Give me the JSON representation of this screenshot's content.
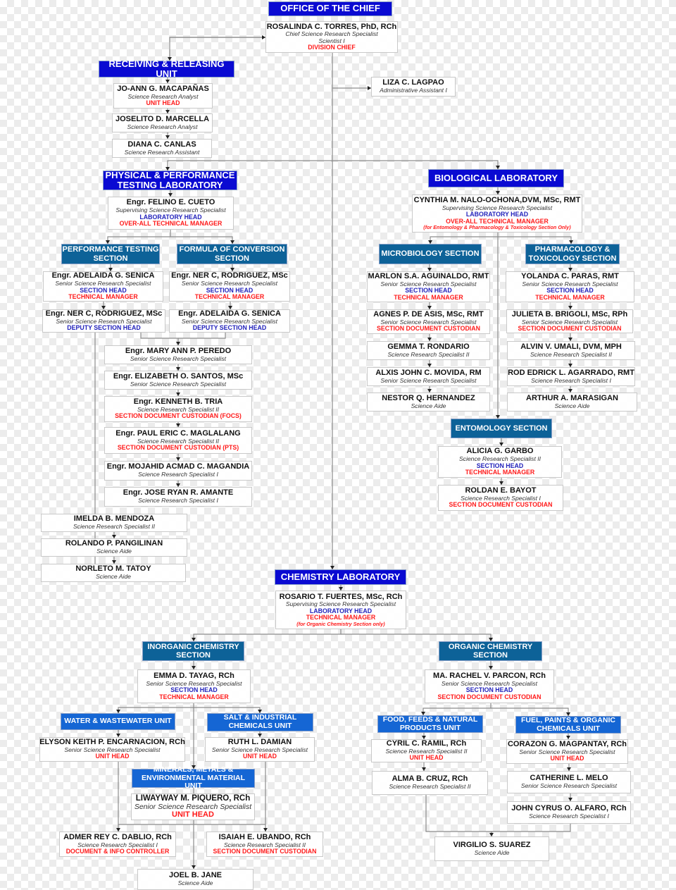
{
  "colors": {
    "office_header": "#0a0ad2",
    "section_header": "#0d6298",
    "unit_header": "#1566d4",
    "red_role": "#ff1a1a",
    "blue_role": "#2222bb",
    "connector": "#8c8c8c"
  },
  "headers": {
    "chief": "OFFICE OF THE CHIEF",
    "rru": "RECEIVING & RELEASING UNIT",
    "ppt": "PHYSICAL & PERFORMANCE TESTING LABORATORY",
    "bio": "BIOLOGICAL LABORATORY",
    "chem": "CHEMISTRY LABORATORY",
    "perf": "PERFORMANCE TESTING SECTION",
    "foc": "FORMULA OF CONVERSION SECTION",
    "micro": "MICROBIOLOGY SECTION",
    "pharm": "PHARMACOLOGY & TOXICOLOGY SECTION",
    "ento": "ENTOMOLOGY  SECTION",
    "inorg": "INORGANIC CHEMISTRY SECTION",
    "org": "ORGANIC CHEMISTRY SECTION",
    "water": "WATER & WASTEWATER UNIT",
    "salt": "SALT & INDUSTRIAL CHEMICALS UNIT",
    "minerals": "MINERALS, METALS & ENVIRONMENTAL MATERIAL UNIT",
    "food": "FOOD, FEEDS & NATURAL PRODUCTS UNIT",
    "fuel": "FUEL, PAINTS & ORGANIC CHEMICALS UNIT"
  },
  "people": {
    "torres": {
      "name": "ROSALINDA C. TORRES, PhD, RCh",
      "position": "Chief Science Research Specialist",
      "roles": [
        {
          "text": "Scientist I",
          "style": "title"
        },
        {
          "text": "DIVISION CHIEF",
          "style": "red"
        }
      ]
    },
    "lagpao": {
      "name": "LIZA C. LAGPAO",
      "position": "Administrative Assistant I",
      "roles": []
    },
    "macapanas": {
      "name": "JO-ANN G. MACAPAÑAS",
      "position": "Science Research Analyst",
      "roles": [
        {
          "text": "UNIT HEAD",
          "style": "red"
        }
      ]
    },
    "marcella": {
      "name": "JOSELITO D. MARCELLA",
      "position": "Science Research Analyst",
      "roles": []
    },
    "canlas": {
      "name": "DIANA C. CANLAS",
      "position": "Science Research Assistant",
      "roles": []
    },
    "cueto": {
      "name": "Engr. FELINO E. CUETO",
      "position": "Supervising Science Research Specialist",
      "roles": [
        {
          "text": "LABORATORY HEAD",
          "style": "blue"
        },
        {
          "text": "OVER-ALL TECHNICAL MANAGER",
          "style": "red"
        }
      ]
    },
    "cynthia": {
      "name": "CYNTHIA M. NALO-OCHONA,DVM, MSc, RMT",
      "position": "Supervising Science Research Specialist",
      "roles": [
        {
          "text": "LABORATORY HEAD",
          "style": "blue"
        },
        {
          "text": "OVER-ALL TECHNICAL MANAGER",
          "style": "red"
        },
        {
          "text": "(for Entomology & Pharmacology & Toxicology Section Only)",
          "style": "note"
        }
      ]
    },
    "senica1": {
      "name": "Engr. ADELAIDA G. SENICA",
      "position": "Senior Science Research Specialist",
      "roles": [
        {
          "text": "SECTION HEAD",
          "style": "blue"
        },
        {
          "text": "TECHNICAL MANAGER",
          "style": "red"
        }
      ]
    },
    "rodriguez1": {
      "name": "Engr. NER C, RODRIGUEZ, MSc",
      "position": "Senior Science Research Specialist",
      "roles": [
        {
          "text": "SECTION HEAD",
          "style": "blue"
        },
        {
          "text": "TECHNICAL MANAGER",
          "style": "red"
        }
      ]
    },
    "rodriguez2": {
      "name": "Engr. NER C, RODRIGUEZ, MSc",
      "position": "Senior Science Research Specialist",
      "roles": [
        {
          "text": "DEPUTY SECTION HEAD",
          "style": "blue"
        }
      ]
    },
    "senica2": {
      "name": "Engr. ADELAIDA G. SENICA",
      "position": "Senior Science Research Specialist",
      "roles": [
        {
          "text": "DEPUTY SECTION HEAD",
          "style": "blue"
        }
      ]
    },
    "peredo": {
      "name": "Engr. MARY ANN P. PEREDO",
      "position": "Senior Science Research Specialist",
      "roles": []
    },
    "santos": {
      "name": "Engr. ELIZABETH O. SANTOS, MSc",
      "position": "Senior Science Research Specialist",
      "roles": []
    },
    "tria": {
      "name": "Engr. KENNETH B. TRIA",
      "position": "Science Research Specialist II",
      "roles": [
        {
          "text": "SECTION DOCUMENT CUSTODIAN (FOCS)",
          "style": "red"
        }
      ]
    },
    "maglalang": {
      "name": "Engr. PAUL ERIC C. MAGLALANG",
      "position": "Science Research Specialist II",
      "roles": [
        {
          "text": "SECTION DOCUMENT CUSTODIAN (PTS)",
          "style": "red"
        }
      ]
    },
    "magandia": {
      "name": "Engr. MOJAHID ACMAD C. MAGANDIA",
      "position": "Science Research Specialist I",
      "roles": []
    },
    "amante": {
      "name": "Engr. JOSE RYAN R. AMANTE",
      "position": "Science Research Specialist I",
      "roles": []
    },
    "mendoza": {
      "name": "IMELDA B. MENDOZA",
      "position": "Science Research Specialist II",
      "roles": []
    },
    "pangilinan": {
      "name": "ROLANDO P. PANGILINAN",
      "position": "Science Aide",
      "roles": []
    },
    "tatoy": {
      "name": "NORLETO M. TATOY",
      "position": "Science Aide",
      "roles": []
    },
    "aguinaldo": {
      "name": "MARLON S.A. AGUINALDO, RMT",
      "position": "Senior Science Research Specialist",
      "roles": [
        {
          "text": "SECTION HEAD",
          "style": "blue"
        },
        {
          "text": "TECHNICAL MANAGER",
          "style": "red"
        }
      ]
    },
    "deasis": {
      "name": "AGNES P. DE ASIS, MSc, RMT",
      "position": "Senior Science Research Specialist",
      "roles": [
        {
          "text": "SECTION DOCUMENT CUSTODIAN",
          "style": "red"
        }
      ]
    },
    "rondario": {
      "name": "GEMMA T. RONDARIO",
      "position": "Science Research Specialist II",
      "roles": []
    },
    "movida": {
      "name": "ALXIS JOHN C. MOVIDA, RM",
      "position": "Senior Science Research Specialist",
      "roles": []
    },
    "hernandez": {
      "name": "NESTOR Q. HERNANDEZ",
      "position": "Science Aide",
      "roles": []
    },
    "paras": {
      "name": "YOLANDA C. PARAS, RMT",
      "position": "Senior Science Research Specialist",
      "roles": [
        {
          "text": "SECTION HEAD",
          "style": "blue"
        },
        {
          "text": "TECHNICAL MANAGER",
          "style": "red"
        }
      ]
    },
    "brigoli": {
      "name": "JULIETA B. BRIGOLI, MSc, RPh",
      "position": "Senior Science Research Specialist",
      "roles": [
        {
          "text": "SECTION DOCUMENT CUSTODIAN",
          "style": "red"
        }
      ]
    },
    "umali": {
      "name": "ALVIN V. UMALI, DVM, MPH",
      "position": "Science Research Specialist II",
      "roles": []
    },
    "agarrado": {
      "name": "ROD EDRICK L. AGARRADO, RMT",
      "position": "Science Research Specialist I",
      "roles": []
    },
    "marasigan": {
      "name": "ARTHUR A. MARASIGAN",
      "position": "Science Aide",
      "roles": []
    },
    "garbo": {
      "name": "ALICIA G. GARBO",
      "position": "Science Research Specialist II",
      "roles": [
        {
          "text": "SECTION HEAD",
          "style": "blue"
        },
        {
          "text": "TECHNICAL MANAGER",
          "style": "red"
        }
      ]
    },
    "bayot": {
      "name": "ROLDAN E. BAYOT",
      "position": "Science Research Specialist I",
      "roles": [
        {
          "text": "SECTION DOCUMENT CUSTODIAN",
          "style": "red"
        }
      ]
    },
    "fuertes": {
      "name": "ROSARIO T. FUERTES, MSc, RCh",
      "position": "Supervising Science Research Specialist",
      "roles": [
        {
          "text": "LABORATORY HEAD",
          "style": "blue"
        },
        {
          "text": "TECHNICAL MANAGER",
          "style": "red"
        },
        {
          "text": "(for Organic Chemistry Section only)",
          "style": "note"
        }
      ]
    },
    "tayag": {
      "name": "EMMA D. TAYAG, RCh",
      "position": "Senior Science Research Specialist",
      "roles": [
        {
          "text": "SECTION HEAD",
          "style": "blue"
        },
        {
          "text": "TECHNICAL MANAGER",
          "style": "red"
        }
      ]
    },
    "parcon": {
      "name": "MA. RACHEL V. PARCON, RCh",
      "position": "Senior Science Research Specialist",
      "roles": [
        {
          "text": "SECTION HEAD",
          "style": "blue"
        },
        {
          "text": "SECTION DOCUMENT CUSTODIAN",
          "style": "red"
        }
      ]
    },
    "encarnacion": {
      "name": "ELYSON KEITH P. ENCARNACION, RCh",
      "position": "Senior Science Research Specialist",
      "roles": [
        {
          "text": "UNIT HEAD",
          "style": "red"
        }
      ]
    },
    "damian": {
      "name": "RUTH L. DAMIAN",
      "position": "Senior Science Research Specialist",
      "roles": [
        {
          "text": "UNIT HEAD",
          "style": "red"
        }
      ]
    },
    "piquero": {
      "name": "LIWAYWAY M. PIQUERO, RCh",
      "position": "Senior Science Research Specialist",
      "roles": [
        {
          "text": "UNIT HEAD",
          "style": "red"
        }
      ]
    },
    "dablio": {
      "name": "ADMER REY C. DABLIO, RCh",
      "position": "Science Research Specialist I",
      "roles": [
        {
          "text": "DOCUMENT & INFO CONTROLLER",
          "style": "red"
        }
      ]
    },
    "ubando": {
      "name": "ISAIAH E. UBANDO, RCh",
      "position": "Science Research Specialist II",
      "roles": [
        {
          "text": "SECTION DOCUMENT CUSTODIAN",
          "style": "red"
        }
      ]
    },
    "jane": {
      "name": "JOEL B. JANE",
      "position": "Science Aide",
      "roles": []
    },
    "ramil": {
      "name": "CYRIL C. RAMIL, RCh",
      "position": "Science Research Specialist  II",
      "roles": [
        {
          "text": "UNIT HEAD",
          "style": "red"
        }
      ]
    },
    "cruz": {
      "name": "ALMA B. CRUZ, RCh",
      "position": "Science Research Specialist II",
      "roles": []
    },
    "magpantay": {
      "name": "CORAZON G. MAGPANTAY, RCh",
      "position": "Senior Science Research Specialist",
      "roles": [
        {
          "text": "UNIT HEAD",
          "style": "red"
        }
      ]
    },
    "melo": {
      "name": "CATHERINE L. MELO",
      "position": "Senior Science Research Specialist",
      "roles": []
    },
    "alfaro": {
      "name": "JOHN CYRUS O. ALFARO, RCh",
      "position": "Science Research Specialist I",
      "roles": []
    },
    "suarez": {
      "name": "VIRGILIO S. SUAREZ",
      "position": "Science Aide",
      "roles": []
    }
  }
}
